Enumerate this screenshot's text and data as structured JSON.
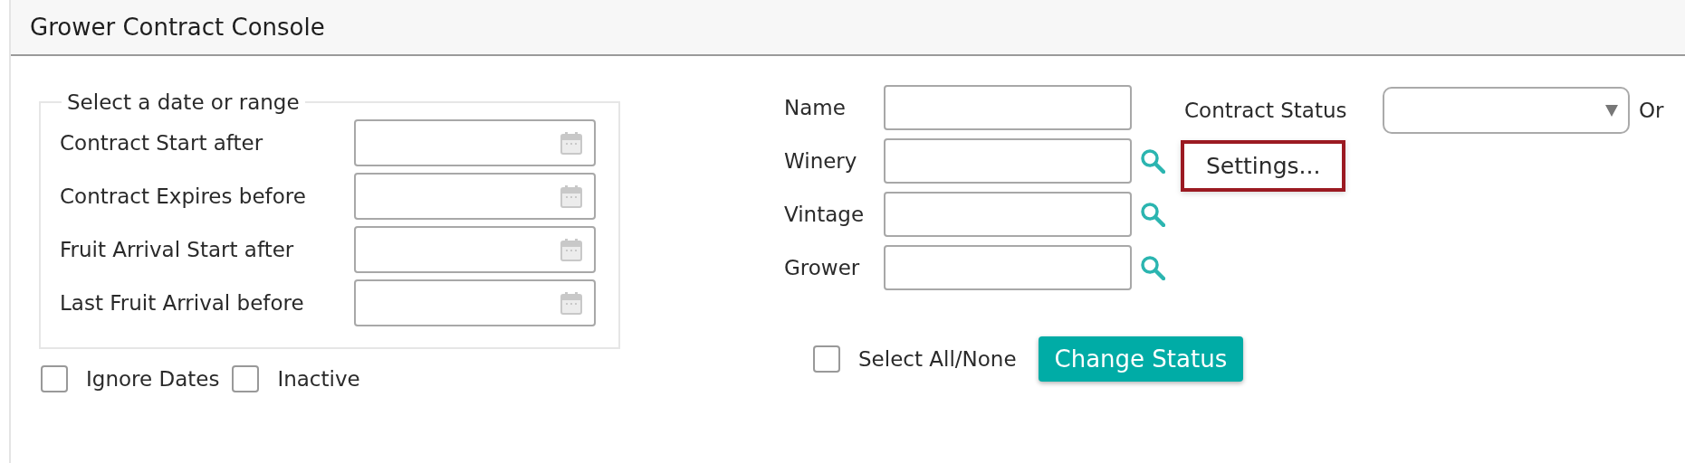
{
  "title": "Grower Contract Console",
  "date_range": {
    "legend": "Select a date or range",
    "fields": [
      {
        "label": "Contract Start after"
      },
      {
        "label": "Contract Expires before"
      },
      {
        "label": "Fruit Arrival Start after"
      },
      {
        "label": "Last Fruit Arrival before"
      }
    ]
  },
  "options": [
    {
      "label": "Ignore Dates",
      "checked": false
    },
    {
      "label": "Inactive",
      "checked": false
    }
  ],
  "filters": [
    {
      "label": "Name",
      "lookup": false
    },
    {
      "label": "Winery",
      "lookup": true
    },
    {
      "label": "Vintage",
      "lookup": true
    },
    {
      "label": "Grower",
      "lookup": true
    }
  ],
  "contract_status": {
    "label": "Contract Status"
  },
  "cut_label": "Or",
  "settings_button": {
    "label": "Settings...",
    "highlighted": true
  },
  "select_all": {
    "label": "Select All/None",
    "checked": false
  },
  "change_status_button": "Change Status"
}
